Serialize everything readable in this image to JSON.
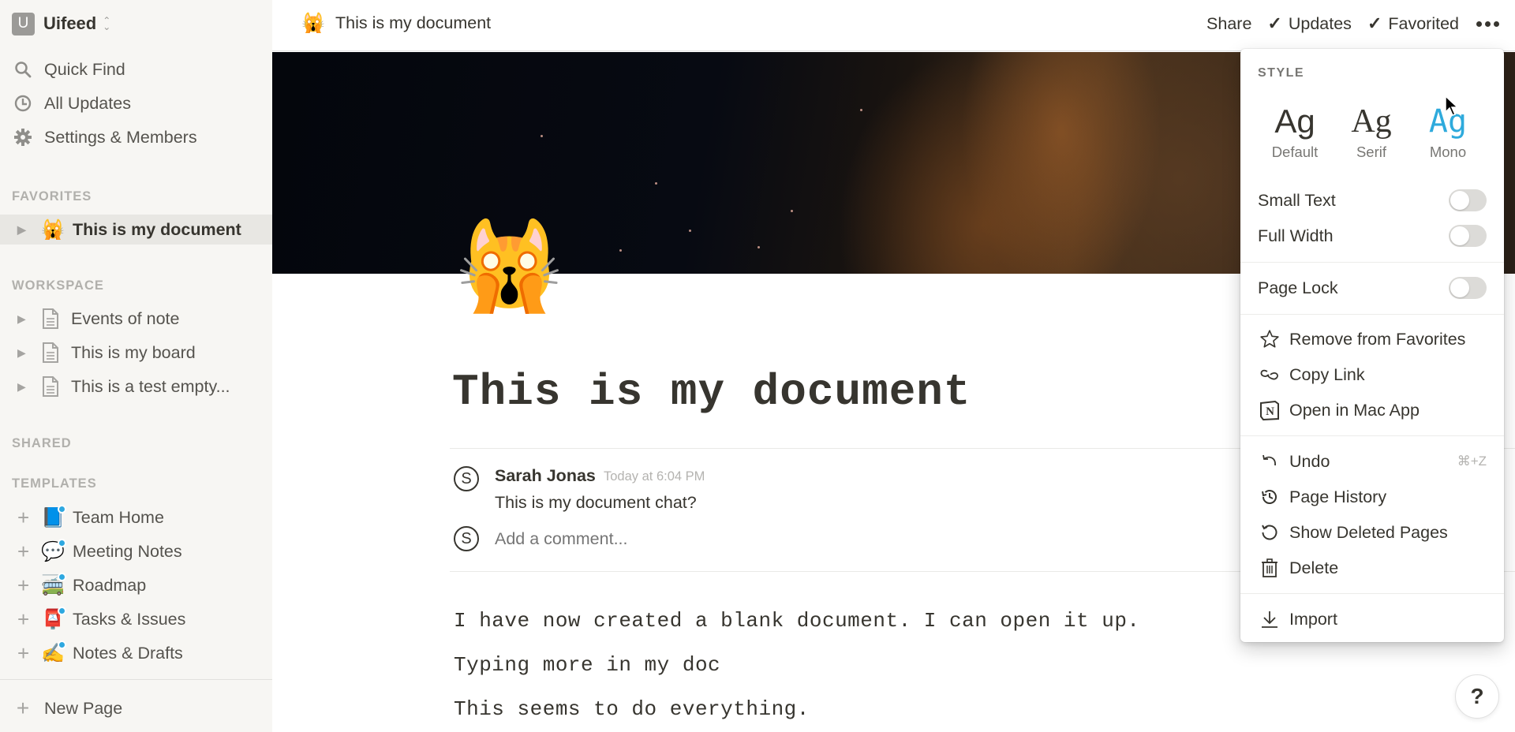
{
  "sidebar": {
    "workspace": {
      "initial": "U",
      "name": "Uifeed"
    },
    "nav": [
      {
        "label": "Quick Find",
        "icon": "search-icon"
      },
      {
        "label": "All Updates",
        "icon": "clock-icon"
      },
      {
        "label": "Settings & Members",
        "icon": "gear-icon"
      }
    ],
    "favorites": {
      "label": "FAVORITES",
      "items": [
        {
          "label": "This is my document",
          "emoji": "🙀"
        }
      ]
    },
    "workspace_section": {
      "label": "WORKSPACE",
      "items": [
        {
          "label": "Events of note"
        },
        {
          "label": "This is my board"
        },
        {
          "label": "This is a test empty..."
        }
      ]
    },
    "shared": {
      "label": "SHARED"
    },
    "templates": {
      "label": "TEMPLATES",
      "items": [
        {
          "label": "Team Home",
          "emoji": "📘"
        },
        {
          "label": "Meeting Notes",
          "emoji": "💬"
        },
        {
          "label": "Roadmap",
          "emoji": "🚎"
        },
        {
          "label": "Tasks & Issues",
          "emoji": "📮"
        },
        {
          "label": "Notes & Drafts",
          "emoji": "✍️"
        }
      ]
    },
    "new_page": "New Page"
  },
  "topbar": {
    "breadcrumb_emoji": "🙀",
    "breadcrumb_title": "This is my document",
    "share": "Share",
    "updates": "Updates",
    "favorited": "Favorited"
  },
  "page": {
    "icon": "🙀",
    "title": "This is my document",
    "comment": {
      "avatar": "S",
      "author": "Sarah Jonas",
      "time": "Today at 6:04 PM",
      "body": "This is my document chat?"
    },
    "comment_input": {
      "avatar": "S",
      "placeholder": "Add a comment..."
    },
    "paragraphs": [
      "I have now created a blank document. I can open it up.",
      "Typing more in my doc",
      "This seems to do everything."
    ]
  },
  "help": "?",
  "menu": {
    "style_label": "STYLE",
    "styles": [
      {
        "glyph": "Ag",
        "label": "Default",
        "selected": false
      },
      {
        "glyph": "Ag",
        "label": "Serif",
        "selected": false
      },
      {
        "glyph": "Ag",
        "label": "Mono",
        "selected": true
      }
    ],
    "toggles": [
      {
        "label": "Small Text",
        "on": false
      },
      {
        "label": "Full Width",
        "on": false
      },
      {
        "label": "Page Lock",
        "on": false
      }
    ],
    "actions": [
      {
        "label": "Remove from Favorites",
        "icon": "star-icon"
      },
      {
        "label": "Copy Link",
        "icon": "link-icon"
      },
      {
        "label": "Open in Mac App",
        "icon": "notion-app-icon"
      }
    ],
    "history": [
      {
        "label": "Undo",
        "icon": "undo-icon",
        "shortcut": "⌘+Z"
      },
      {
        "label": "Page History",
        "icon": "history-icon"
      },
      {
        "label": "Show Deleted Pages",
        "icon": "restore-icon"
      },
      {
        "label": "Delete",
        "icon": "trash-icon"
      }
    ],
    "import": {
      "label": "Import",
      "icon": "download-icon"
    }
  },
  "colors": {
    "accent": "#2eaadc",
    "sidebar_bg": "#f7f6f3",
    "text": "#37352f"
  }
}
